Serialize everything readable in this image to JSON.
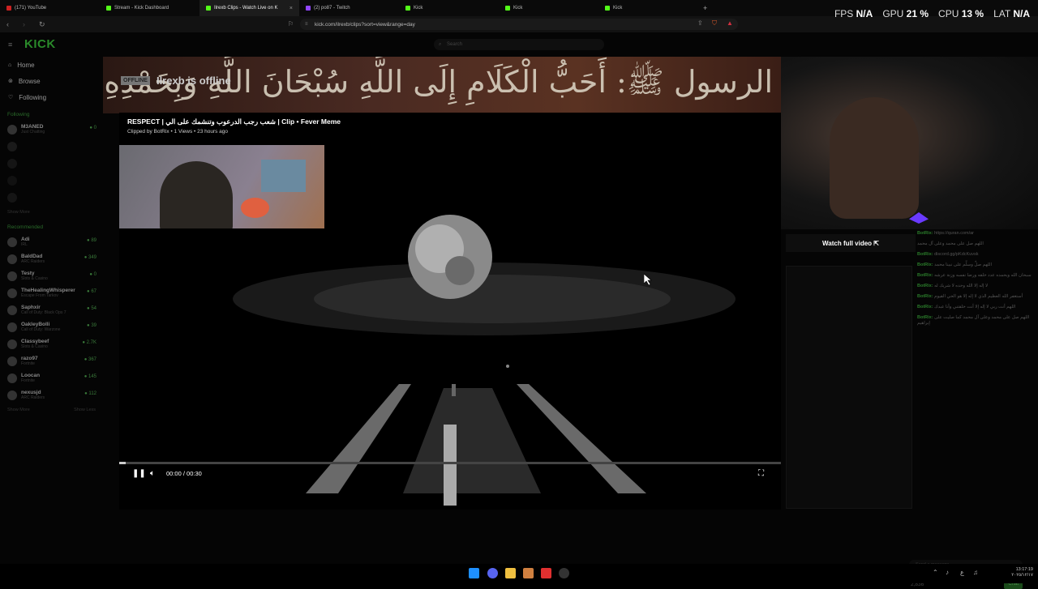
{
  "browser": {
    "tabs": [
      {
        "label": "(171) YouTube",
        "color": "#cc2222"
      },
      {
        "label": "Stream - Kick Dashboard",
        "color": "#53fc18"
      },
      {
        "label": "Ilrexb Clips - Watch Live on K",
        "color": "#53fc18",
        "active": true
      },
      {
        "label": "(2) po87 - Twitch",
        "color": "#9146ff"
      },
      {
        "label": "Kick",
        "color": "#53fc18"
      },
      {
        "label": "Kick",
        "color": "#53fc18"
      },
      {
        "label": "Kick",
        "color": "#53fc18"
      }
    ],
    "new_tab": "+",
    "url": "kick.com/ilrexb/clips?sort=view&range=day"
  },
  "perf": {
    "fps_label": "FPS",
    "fps_value": "N/A",
    "gpu_label": "GPU",
    "gpu_value": "21 %",
    "cpu_label": "CPU",
    "cpu_value": "13 %",
    "lat_label": "LAT",
    "lat_value": "N/A"
  },
  "kick": {
    "logo": "KICK",
    "search_placeholder": "Search",
    "nav": [
      {
        "label": "Home",
        "icon": "home-icon"
      },
      {
        "label": "Browse",
        "icon": "browse-icon"
      },
      {
        "label": "Following",
        "icon": "heart-icon"
      }
    ],
    "following_title": "Following",
    "following": [
      {
        "name": "M3ANED",
        "category": "Just Chatting",
        "viewers": "0"
      }
    ],
    "recommended_title": "Recommended",
    "recommended": [
      {
        "name": "Adi",
        "category": "IRL",
        "viewers": "89"
      },
      {
        "name": "BaldDad",
        "category": "ARC Raiders",
        "viewers": "349"
      },
      {
        "name": "Testy",
        "category": "Slots & Casino",
        "viewers": "0"
      },
      {
        "name": "TheHealingWhisperer",
        "category": "Escape From Tarkov",
        "viewers": "67"
      },
      {
        "name": "Saphxir",
        "category": "Call of Duty: Black Ops 7",
        "viewers": "54"
      },
      {
        "name": "OakleyBolli",
        "category": "Call of Duty: Warzone",
        "viewers": "39"
      },
      {
        "name": "Classybeef",
        "category": "Slots & Casino",
        "viewers": "2.7K"
      },
      {
        "name": "razo97",
        "category": "Fortnite",
        "viewers": "367"
      },
      {
        "name": "Loocan",
        "category": "Fortnite",
        "viewers": "145"
      },
      {
        "name": "nexusjd",
        "category": "ARC Raiders",
        "viewers": "112"
      }
    ],
    "show_more": "Show More",
    "show_less": "Show Less"
  },
  "banner": {
    "offline_badge": "OFFLINE",
    "offline_text": "Ilrexb is offline",
    "arabic": "الرسول ﷺ: أَحَبُّ الْكَلَامِ إِلَى اللَّهِ سُبْحَانَ اللَّهِ وَبِحَمْدِهِ"
  },
  "clip": {
    "title": "RESPECT | شعب رجب الدرعوب وتنشمك على الي | Clip • Fever Meme",
    "meta": "Clipped by BotRix • 1 Views • 23 hours ago",
    "time": "00:00 / 00:30",
    "progress": 0.01
  },
  "chat": {
    "watch_full": "Watch full video ⇱",
    "messages": [
      {
        "user": "BotRix:",
        "text": "https://quran.com/ar"
      },
      {
        "user": "",
        "text": "اللهم صل على محمد وعلى آل محمد"
      },
      {
        "user": "BotRix:",
        "text": "discord.gg/pKdcKuvsk"
      },
      {
        "user": "BotRix:",
        "text": "اللهم صلِّ وسلِّم على نبينا محمد"
      },
      {
        "user": "BotRix:",
        "text": "سبحان الله وبحمده عدد خلقه ورضا نفسه وزنة عرشه"
      },
      {
        "user": "BotRix:",
        "text": "لا إله إلا الله وحده لا شريك له"
      },
      {
        "user": "BotRix:",
        "text": "أستغفر الله العظيم الذي لا إله إلا هو الحي القيوم"
      },
      {
        "user": "BotRix:",
        "text": "اللهم أنت ربي لا إله إلا أنت خلقتني وأنا عبدك"
      },
      {
        "user": "BotRix:",
        "text": "اللهم صل على محمد وعلى آل محمد كما صليت على إبراهيم"
      }
    ],
    "input_placeholder": "Send a message",
    "points": "2,836",
    "send": "Chat"
  },
  "taskbar": {
    "time": "13:17:19",
    "date": "٢٠٢٥/١٢/١٧"
  }
}
